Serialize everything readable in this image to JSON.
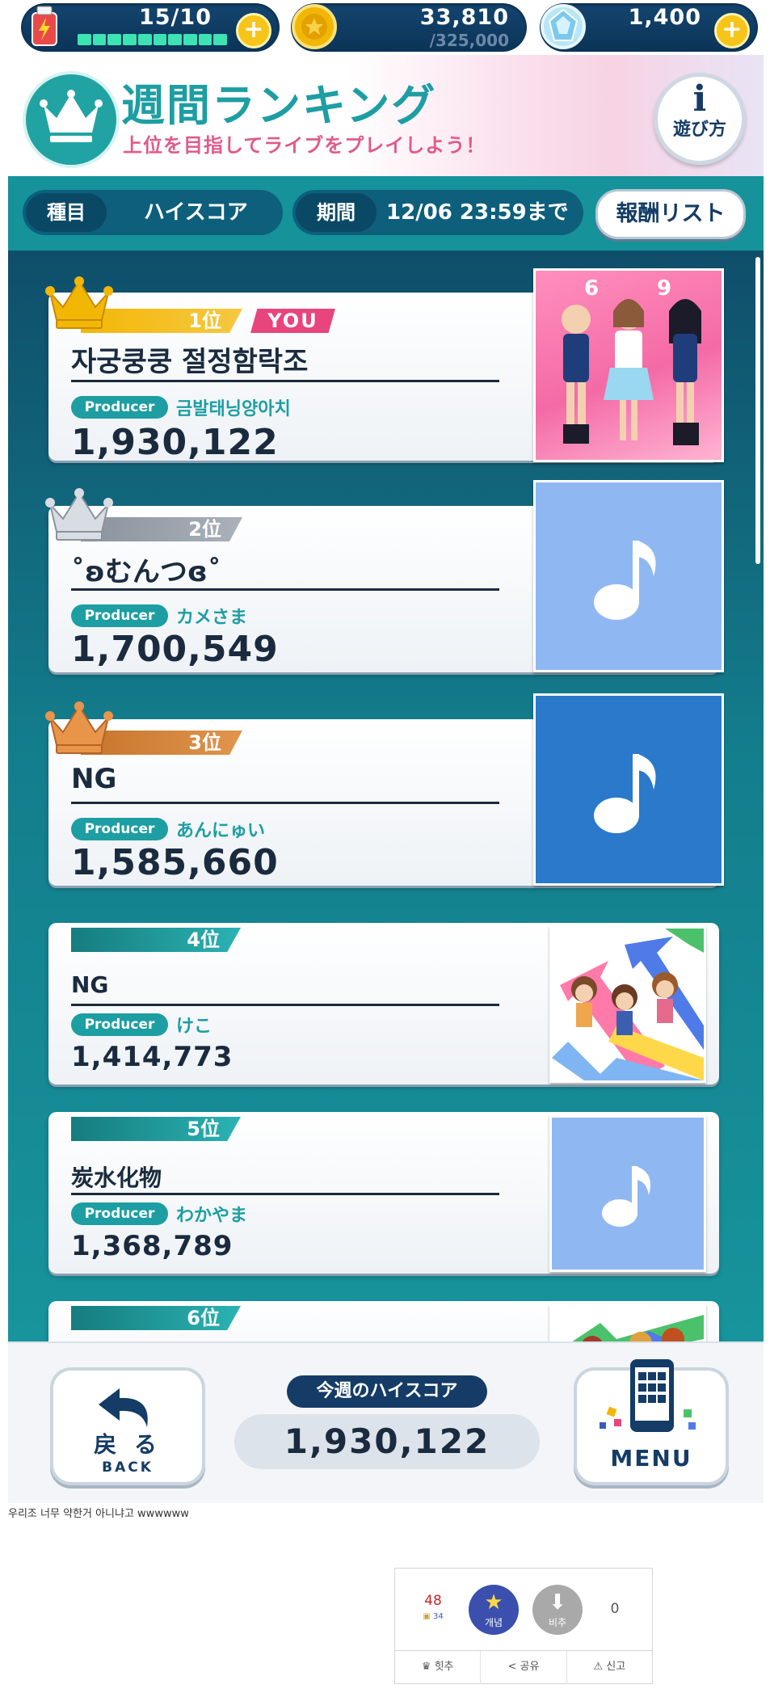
{
  "resources": {
    "stamina": "15/10",
    "coins": "33,810",
    "coins_max": "/325,000",
    "jewels": "1,400"
  },
  "header": {
    "title": "週間ランキング",
    "subtitle": "上位を目指してライブをプレイしよう！",
    "howto_icon": "i",
    "howto_label": "遊び方"
  },
  "filter": {
    "type_label": "種目",
    "type_value": "ハイスコア",
    "period_label": "期間",
    "period_value": "12/06 23:59まで",
    "rewards_button": "報酬リスト"
  },
  "producer_tag": "Producer",
  "you_tag": "YOU",
  "ranking": [
    {
      "rank": "1位",
      "name": "자궁쿵쿵 절정함락조",
      "producer": "금발태닝양아치",
      "score": "1,930,122",
      "thumb": "idol-art-pink"
    },
    {
      "rank": "2位",
      "name": "˚ʚむんつɞ˚",
      "producer": "カメさま",
      "score": "1,700,549",
      "thumb": "music-note-lightblue"
    },
    {
      "rank": "3位",
      "name": "NG",
      "producer": "あんにゅい",
      "score": "1,585,660",
      "thumb": "music-note-blue"
    },
    {
      "rank": "4位",
      "name": "NG",
      "producer": "けこ",
      "score": "1,414,773",
      "thumb": "chibi-art"
    },
    {
      "rank": "5位",
      "name": "炭水化物",
      "producer": "わかやま",
      "score": "1,368,789",
      "thumb": "music-note-lightblue"
    },
    {
      "rank": "6位"
    }
  ],
  "footer": {
    "back_label": "戻 る",
    "back_sub": "BACK",
    "weekly_label": "今週のハイスコア",
    "weekly_value": "1,930,122",
    "menu_label": "MENU"
  },
  "caption": "우리조 너무 약한거 아니냐고 wwwwww",
  "votes": {
    "up_count": "48",
    "sub_count": "34",
    "upvote_label": "개념",
    "downvote_label": "비추",
    "down_count": "0",
    "actions": [
      "힛추",
      "공유",
      "신고"
    ]
  },
  "colors": {
    "teal": "#1d9ea3",
    "navy": "#143c66",
    "pink": "#e8457d",
    "gold": "#f2b705",
    "silver": "#9aa3ad",
    "bronze": "#d98a3e"
  }
}
